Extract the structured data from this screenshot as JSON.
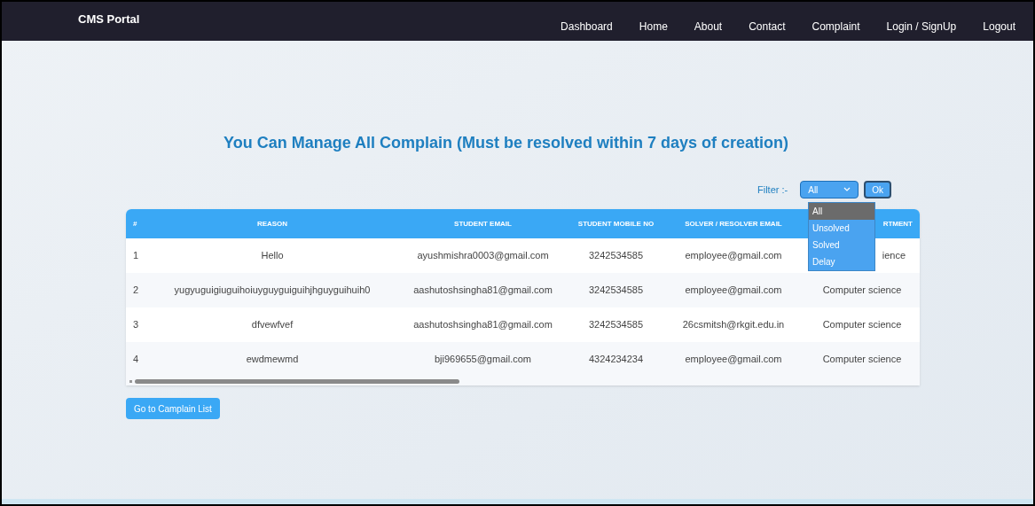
{
  "navbar": {
    "brand": "CMS Portal",
    "links": [
      "Dashboard",
      "Home",
      "About",
      "Contact",
      "Complaint",
      "Login / SignUp",
      "Logout"
    ]
  },
  "heading": "You Can Manage All Complain (Must be resolved within 7 days of creation)",
  "filter": {
    "label": "Filter :-",
    "value": "All",
    "button": "Ok",
    "expanded": true,
    "options": [
      {
        "label": "All",
        "selected": true
      },
      {
        "label": "Unsolved",
        "selected": false
      },
      {
        "label": "Solved",
        "selected": false
      },
      {
        "label": "Delay",
        "selected": false
      }
    ]
  },
  "table": {
    "columns": [
      "#",
      "REASON",
      "STUDENT EMAIL",
      "STUDENT MOBILE NO",
      "SOLVER / RESOLVER EMAIL",
      "RTMENT"
    ],
    "rows": [
      [
        "1",
        "Hello",
        "ayushmishra0003@gmail.com",
        "3242534585",
        "employee@gmail.com",
        "ience"
      ],
      [
        "2",
        "yugyuguigiuguihoiuyguyguiguihjhguyguihuih0",
        "aashutoshsingha81@gmail.com",
        "3242534585",
        "employee@gmail.com",
        "Computer science"
      ],
      [
        "3",
        "dfvewfvef",
        "aashutoshsingha81@gmail.com",
        "3242534585",
        "26csmitsh@rkgit.edu.in",
        "Computer science"
      ],
      [
        "4",
        "ewdmewmd",
        "bji969655@gmail.com",
        "4324234234",
        "employee@gmail.com",
        "Computer science"
      ]
    ]
  },
  "list_button": "Go to Camplain List"
}
